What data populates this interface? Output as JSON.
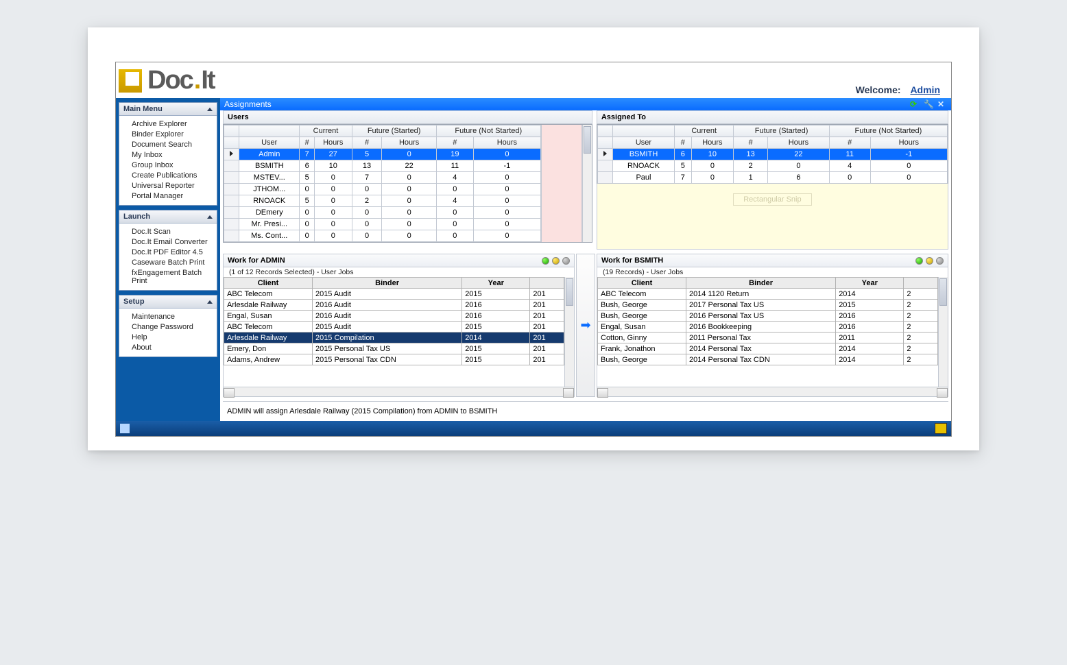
{
  "header": {
    "welcome": "Welcome:",
    "user": "Admin"
  },
  "logo": {
    "text1": "Doc",
    "dot": ".",
    "text2": "It"
  },
  "sidebar": {
    "mainmenu": {
      "title": "Main Menu",
      "items": [
        "Archive Explorer",
        "Binder Explorer",
        "Document Search",
        "My Inbox",
        "Group Inbox",
        "Create Publications",
        "Universal Reporter",
        "Portal Manager"
      ]
    },
    "launch": {
      "title": "Launch",
      "items": [
        "Doc.It Scan",
        "Doc.It Email Converter",
        "Doc.It PDF Editor 4.5",
        "Caseware Batch Print",
        "fxEngagement Batch Print"
      ]
    },
    "setup": {
      "title": "Setup",
      "items": [
        "Maintenance",
        "Change Password",
        "Help",
        "About"
      ]
    }
  },
  "window": {
    "title": "Assignments"
  },
  "users": {
    "title": "Users",
    "groupHeaders": [
      "Current",
      "Future (Started)",
      "Future (Not Started)"
    ],
    "cols": [
      "User",
      "#",
      "Hours",
      "#",
      "Hours",
      "#",
      "Hours"
    ],
    "rows": [
      {
        "sel": true,
        "c": [
          "Admin",
          "7",
          "27",
          "5",
          "0",
          "19",
          "0"
        ]
      },
      {
        "sel": false,
        "c": [
          "BSMITH",
          "6",
          "10",
          "13",
          "22",
          "11",
          "-1"
        ]
      },
      {
        "sel": false,
        "c": [
          "MSTEV...",
          "5",
          "0",
          "7",
          "0",
          "4",
          "0"
        ]
      },
      {
        "sel": false,
        "c": [
          "JTHOM...",
          "0",
          "0",
          "0",
          "0",
          "0",
          "0"
        ]
      },
      {
        "sel": false,
        "c": [
          "RNOACK",
          "5",
          "0",
          "2",
          "0",
          "4",
          "0"
        ]
      },
      {
        "sel": false,
        "c": [
          "DEmery",
          "0",
          "0",
          "0",
          "0",
          "0",
          "0"
        ]
      },
      {
        "sel": false,
        "c": [
          "Mr. Presi...",
          "0",
          "0",
          "0",
          "0",
          "0",
          "0"
        ]
      },
      {
        "sel": false,
        "c": [
          "Ms. Cont...",
          "0",
          "0",
          "0",
          "0",
          "0",
          "0"
        ]
      }
    ]
  },
  "assigned": {
    "title": "Assigned To",
    "groupHeaders": [
      "Current",
      "Future (Started)",
      "Future (Not Started)"
    ],
    "cols": [
      "User",
      "#",
      "Hours",
      "#",
      "Hours",
      "#",
      "Hours"
    ],
    "rows": [
      {
        "sel": true,
        "c": [
          "BSMITH",
          "6",
          "10",
          "13",
          "22",
          "11",
          "-1"
        ]
      },
      {
        "sel": false,
        "c": [
          "RNOACK",
          "5",
          "0",
          "2",
          "0",
          "4",
          "0"
        ]
      },
      {
        "sel": false,
        "c": [
          "Paul",
          "7",
          "0",
          "1",
          "6",
          "0",
          "0"
        ]
      }
    ],
    "ghostBtn": "Rectangular Snip"
  },
  "workLeft": {
    "title": "Work for ADMIN",
    "records": "(1 of 12 Records Selected) - User Jobs",
    "cols": [
      "Client",
      "Binder",
      "Year",
      ""
    ],
    "rows": [
      {
        "sel": false,
        "c": [
          "ABC Telecom",
          "2015 Audit",
          "2015",
          "201"
        ]
      },
      {
        "sel": false,
        "c": [
          "Arlesdale Railway",
          "2016 Audit",
          "2016",
          "201"
        ]
      },
      {
        "sel": false,
        "c": [
          "Engal, Susan",
          "2016 Audit",
          "2016",
          "201"
        ]
      },
      {
        "sel": false,
        "c": [
          "ABC Telecom",
          "2015 Audit",
          "2015",
          "201"
        ]
      },
      {
        "sel": true,
        "c": [
          "Arlesdale Railway",
          "2015 Compilation",
          "2014",
          "201"
        ]
      },
      {
        "sel": false,
        "c": [
          "Emery, Don",
          "2015 Personal Tax  US",
          "2015",
          "201"
        ]
      },
      {
        "sel": false,
        "c": [
          "Adams, Andrew",
          "2015 Personal Tax CDN",
          "2015",
          "201"
        ]
      }
    ]
  },
  "workRight": {
    "title": "Work for BSMITH",
    "records": "(19 Records) - User Jobs",
    "cols": [
      "Client",
      "Binder",
      "Year",
      ""
    ],
    "rows": [
      {
        "sel": false,
        "c": [
          "ABC Telecom",
          "2014 1120 Return",
          "2014",
          "2"
        ]
      },
      {
        "sel": false,
        "c": [
          "Bush, George",
          "2017 Personal Tax  US",
          "2015",
          "2"
        ]
      },
      {
        "sel": false,
        "c": [
          "Bush, George",
          "2016 Personal Tax  US",
          "2016",
          "2"
        ]
      },
      {
        "sel": false,
        "c": [
          "Engal, Susan",
          "2016 Bookkeeping",
          "2016",
          "2"
        ]
      },
      {
        "sel": false,
        "c": [
          "Cotton, Ginny",
          "2011 Personal Tax",
          "2011",
          "2"
        ]
      },
      {
        "sel": false,
        "c": [
          "Frank, Jonathon",
          "2014 Personal Tax",
          "2014",
          "2"
        ]
      },
      {
        "sel": false,
        "c": [
          "Bush, George",
          "2014 Personal Tax CDN",
          "2014",
          "2"
        ]
      }
    ]
  },
  "statusMsg": "ADMIN will assign  Arlesdale Railway (2015 Compilation) from ADMIN to BSMITH"
}
